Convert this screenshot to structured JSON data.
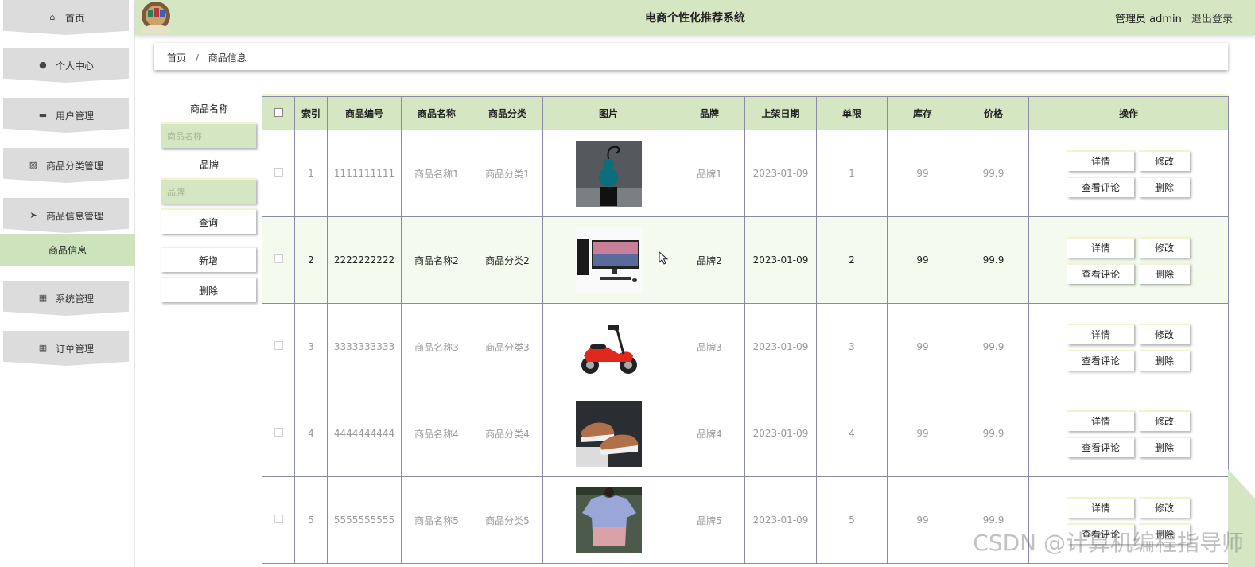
{
  "app": {
    "title": "电商个性化推荐系统",
    "user": "管理员 admin",
    "logout": "退出登录"
  },
  "sidebar": {
    "items": [
      {
        "label": "首页",
        "icon": "home-icon",
        "glyph": "⌂"
      },
      {
        "label": "个人中心",
        "icon": "user-icon",
        "glyph": "●"
      },
      {
        "label": "用户管理",
        "icon": "user-manage-icon",
        "glyph": "▬"
      },
      {
        "label": "商品分类管理",
        "icon": "chart-icon",
        "glyph": "▨"
      },
      {
        "label": "商品信息管理",
        "icon": "send-icon",
        "glyph": "➤"
      },
      {
        "label": "系统管理",
        "icon": "grid-icon",
        "glyph": "▦"
      },
      {
        "label": "订单管理",
        "icon": "grid-icon",
        "glyph": "▦"
      }
    ],
    "active_sub": "商品信息"
  },
  "breadcrumb": {
    "home": "首页",
    "sep": "/",
    "current": "商品信息"
  },
  "filter": {
    "name_label": "商品名称",
    "name_placeholder": "商品名称",
    "brand_label": "品牌",
    "brand_placeholder": "品牌",
    "search": "查询",
    "add": "新增",
    "delete": "删除"
  },
  "table": {
    "headers": [
      "索引",
      "商品编号",
      "商品名称",
      "商品分类",
      "图片",
      "品牌",
      "上架日期",
      "单限",
      "库存",
      "价格",
      "操作"
    ],
    "actions": {
      "detail": "详情",
      "edit": "修改",
      "comments": "查看评论",
      "delete": "删除"
    },
    "rows": [
      {
        "index": "1",
        "code": "1111111111",
        "name": "商品名称1",
        "category": "商品分类1",
        "image": "vase-image",
        "brand": "品牌1",
        "date": "2023-01-09",
        "limit": "1",
        "stock": "99",
        "price": "99.9"
      },
      {
        "index": "2",
        "code": "2222222222",
        "name": "商品名称2",
        "category": "商品分类2",
        "image": "computer-image",
        "brand": "品牌2",
        "date": "2023-01-09",
        "limit": "2",
        "stock": "99",
        "price": "99.9"
      },
      {
        "index": "3",
        "code": "3333333333",
        "name": "商品名称3",
        "category": "商品分类3",
        "image": "scooter-image",
        "brand": "品牌3",
        "date": "2023-01-09",
        "limit": "3",
        "stock": "99",
        "price": "99.9"
      },
      {
        "index": "4",
        "code": "4444444444",
        "name": "商品名称4",
        "category": "商品分类4",
        "image": "shoes-image",
        "brand": "品牌4",
        "date": "2023-01-09",
        "limit": "4",
        "stock": "99",
        "price": "99.9"
      },
      {
        "index": "5",
        "code": "5555555555",
        "name": "商品名称5",
        "category": "商品分类5",
        "image": "shirt-image",
        "brand": "品牌5",
        "date": "2023-01-09",
        "limit": "5",
        "stock": "99",
        "price": "99.9"
      }
    ]
  },
  "watermark": "CSDN @计算机编程指导师",
  "colors": {
    "accent": "#d4e6c2",
    "nav_bg": "#dcdcdc",
    "active": "#cde3bc",
    "highlight_row": "#f4fbee",
    "border": "#8a8aa6"
  }
}
